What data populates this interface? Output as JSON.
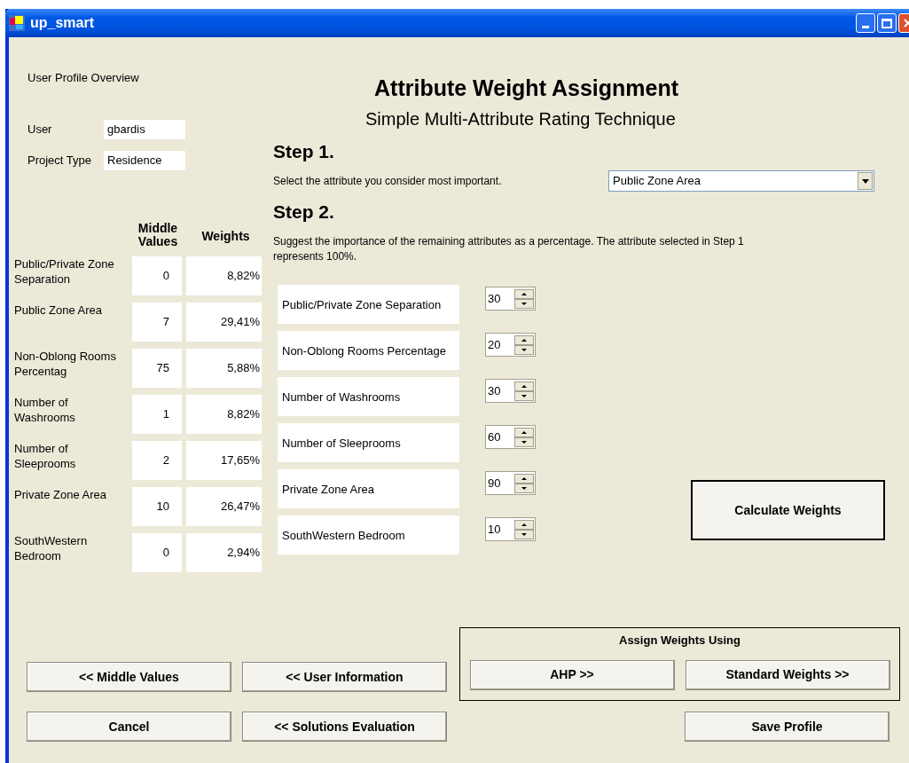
{
  "window": {
    "title": "up_smart"
  },
  "profile": {
    "heading": "User Profile Overview",
    "fields": [
      {
        "label": "User",
        "value": "gbardis"
      },
      {
        "label": "Project Type",
        "value": "Residence"
      }
    ]
  },
  "summary": {
    "columns": [
      "Middle Values",
      "Weights"
    ],
    "rows": [
      {
        "name": "Public/Private Zone Separation",
        "middle_value": "0",
        "weight": "8,82%"
      },
      {
        "name": "Public Zone Area",
        "middle_value": "7",
        "weight": "29,41%"
      },
      {
        "name": "Non-Oblong Rooms Percentag",
        "middle_value": "75",
        "weight": "5,88%"
      },
      {
        "name": "Number of Washrooms",
        "middle_value": "1",
        "weight": "8,82%"
      },
      {
        "name": "Number of Sleeprooms",
        "middle_value": "2",
        "weight": "17,65%"
      },
      {
        "name": "Private Zone Area",
        "middle_value": "10",
        "weight": "26,47%"
      },
      {
        "name": "SouthWestern Bedroom",
        "middle_value": "0",
        "weight": "2,94%"
      }
    ]
  },
  "header": {
    "title": "Attribute Weight Assignment",
    "subtitle": "Simple Multi-Attribute Rating Technique"
  },
  "step1": {
    "heading": "Step 1.",
    "instruction": "Select the attribute you consider most important.",
    "dropdown": {
      "value": "Public Zone Area"
    }
  },
  "step2": {
    "heading": "Step 2.",
    "instruction": "Suggest the importance of the remaining attributes as a percentage. The attribute selected in Step 1 represents 100%.",
    "attributes": [
      {
        "label": "Public/Private Zone Separation",
        "value": "30"
      },
      {
        "label": "Non-Oblong Rooms Percentage",
        "value": "20"
      },
      {
        "label": "Number of Washrooms",
        "value": "30"
      },
      {
        "label": "Number of Sleeprooms",
        "value": "60"
      },
      {
        "label": "Private Zone Area",
        "value": "90"
      },
      {
        "label": "SouthWestern Bedroom",
        "value": "10"
      }
    ]
  },
  "calculate_button": "Calculate Weights",
  "assign_group": {
    "label": "Assign Weights Using",
    "buttons": [
      "AHP >>",
      "Standard Weights >>"
    ]
  },
  "nav_buttons": [
    [
      "<< Middle Values",
      "<< User Information"
    ],
    [
      "Cancel",
      "<< Solutions Evaluation"
    ]
  ],
  "save_button": "Save Profile"
}
